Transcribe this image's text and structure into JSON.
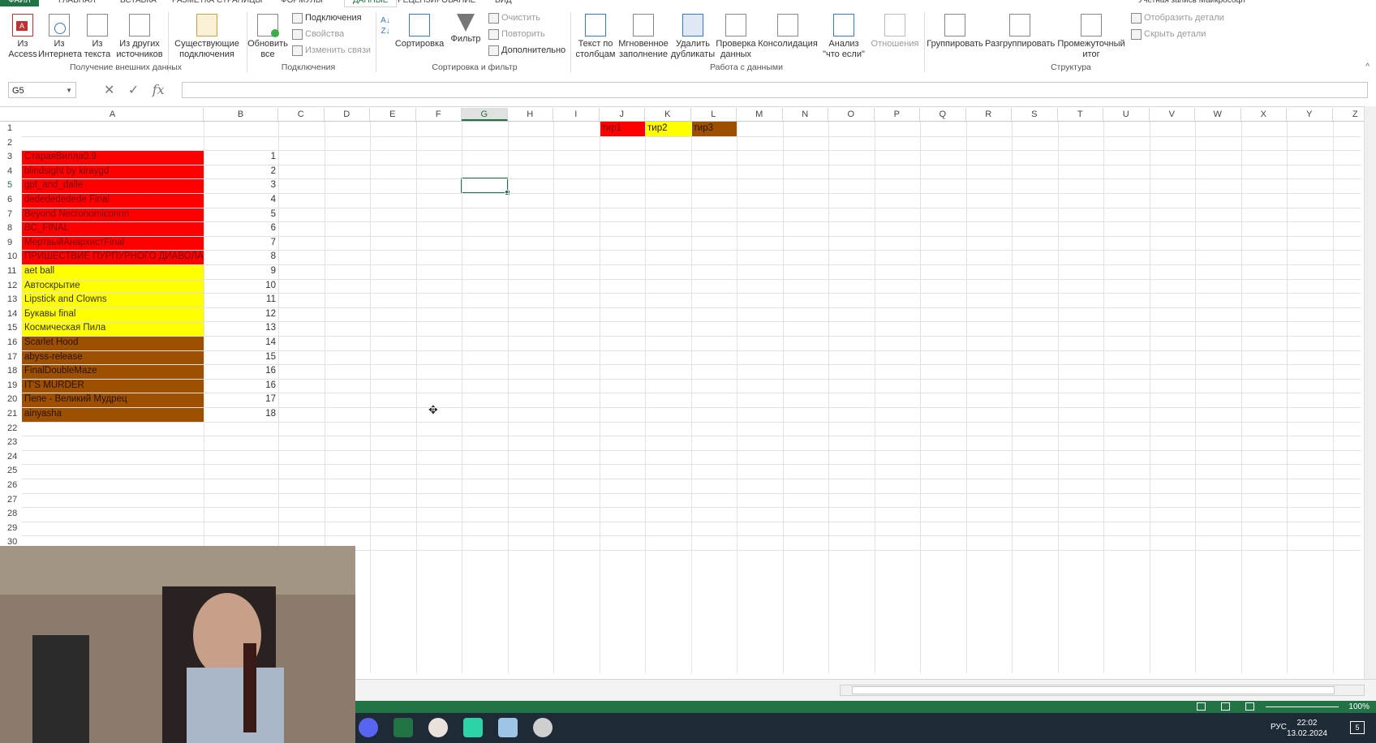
{
  "ribbon_tabs": [
    "ФАЙЛ",
    "ГЛАВНАЯ",
    "ВСТАВКА",
    "РАЗМЕТКА СТРАНИЦЫ",
    "ФОРМУЛЫ",
    "ДАННЫЕ",
    "РЕЦЕНЗИРОВАНИЕ",
    "ВИД"
  ],
  "account": "Учетная запись Майкрософт",
  "ribbon": {
    "from_access": "Из Access",
    "from_web": "Из Интернета",
    "from_text": "Из текста",
    "from_other": "Из других источников",
    "existing": "Существующие подключения",
    "group_external": "Получение внешних данных",
    "refresh_all": "Обновить все",
    "connections": "Подключения",
    "properties": "Свойства",
    "edit_links": "Изменить связи",
    "group_connections": "Подключения",
    "sort": "Сортировка",
    "filter": "Фильтр",
    "clear": "Очистить",
    "reapply": "Повторить",
    "advanced": "Дополнительно",
    "group_sortfilter": "Сортировка и фильтр",
    "text_to_columns": "Текст по столбцам",
    "flash_fill": "Мгновенное заполнение",
    "remove_dupes": "Удалить дубликаты",
    "validation": "Проверка данных",
    "consolidate": "Консолидация",
    "whatif": "Анализ \"что если\"",
    "relationships": "Отношения",
    "group_datatools": "Работа с данными",
    "group_btn": "Группировать",
    "ungroup_btn": "Разгруппировать",
    "subtotal": "Промежуточный итог",
    "show_detail": "Отобразить детали",
    "hide_detail": "Скрыть детали",
    "group_outline": "Структура"
  },
  "namebox": "G5",
  "fx_label": "fx",
  "columns": [
    "A",
    "B",
    "C",
    "D",
    "E",
    "F",
    "G",
    "H",
    "I",
    "J",
    "K",
    "L",
    "M",
    "N",
    "O",
    "P",
    "Q",
    "R",
    "S",
    "T",
    "U",
    "V",
    "W",
    "X",
    "Y",
    "Z"
  ],
  "rows": [
    {
      "n": "1",
      "a": "",
      "b": ""
    },
    {
      "n": "2",
      "a": "",
      "b": ""
    },
    {
      "n": "3",
      "a": "СтараяВилла0.9",
      "b": "1",
      "fill": "red"
    },
    {
      "n": "4",
      "a": "blindsight by kiraygd",
      "b": "2",
      "fill": "red"
    },
    {
      "n": "5",
      "a": "gpt_and_dalle",
      "b": "3",
      "fill": "red"
    },
    {
      "n": "6",
      "a": "dededededede Final",
      "b": "4",
      "fill": "red"
    },
    {
      "n": "7",
      "a": "Beyond Necronomiconnn",
      "b": "5",
      "fill": "red"
    },
    {
      "n": "8",
      "a": "BC_FINAL",
      "b": "6",
      "fill": "red"
    },
    {
      "n": "9",
      "a": "МертвыйАнархистFinal",
      "b": "7",
      "fill": "red"
    },
    {
      "n": "10",
      "a": "ПРИШЕСТВИЕ ПУРПУРНОГО ДИАВОЛА",
      "b": "8",
      "fill": "red"
    },
    {
      "n": "11",
      "a": "aet ball",
      "b": "9",
      "fill": "yellow"
    },
    {
      "n": "12",
      "a": "Автоскрытие",
      "b": "10",
      "fill": "yellow"
    },
    {
      "n": "13",
      "a": "Lipstick and Clowns",
      "b": "11",
      "fill": "yellow"
    },
    {
      "n": "14",
      "a": "Букавы final",
      "b": "12",
      "fill": "yellow"
    },
    {
      "n": "15",
      "a": "Космическая Пила",
      "b": "13",
      "fill": "yellow"
    },
    {
      "n": "16",
      "a": "Scarlet Hood",
      "b": "14",
      "fill": "brown"
    },
    {
      "n": "17",
      "a": "abyss-release",
      "b": "15",
      "fill": "brown"
    },
    {
      "n": "18",
      "a": "FinalDoubleMaze",
      "b": "16",
      "fill": "brown"
    },
    {
      "n": "19",
      "a": "IT'S MURDER",
      "b": "16",
      "fill": "brown"
    },
    {
      "n": "20",
      "a": "Пепе - Великий Мудрец",
      "b": "17",
      "fill": "brown"
    },
    {
      "n": "21",
      "a": "ainyasha",
      "b": "18",
      "fill": "brown"
    },
    {
      "n": "22",
      "a": "",
      "b": ""
    },
    {
      "n": "23",
      "a": "",
      "b": ""
    },
    {
      "n": "24",
      "a": "",
      "b": ""
    },
    {
      "n": "25",
      "a": "",
      "b": ""
    },
    {
      "n": "26",
      "a": "",
      "b": ""
    },
    {
      "n": "27",
      "a": "",
      "b": ""
    },
    {
      "n": "28",
      "a": "",
      "b": ""
    },
    {
      "n": "29",
      "a": "",
      "b": ""
    },
    {
      "n": "30",
      "a": "",
      "b": ""
    }
  ],
  "tiers": [
    {
      "col": "J",
      "label": "тир1",
      "fill": "red"
    },
    {
      "col": "K",
      "label": "тир2",
      "fill": "yellow"
    },
    {
      "col": "L",
      "label": "тир3",
      "fill": "brown"
    }
  ],
  "colors": {
    "red": "#ff0000",
    "yellow": "#ffff00",
    "brown": "#9c5000",
    "excel_green": "#217346"
  },
  "status": {
    "zoom": "100%"
  },
  "taskbar": {
    "lang": "РУС",
    "time": "22:02",
    "date": "13.02.2024",
    "notif": "5"
  }
}
